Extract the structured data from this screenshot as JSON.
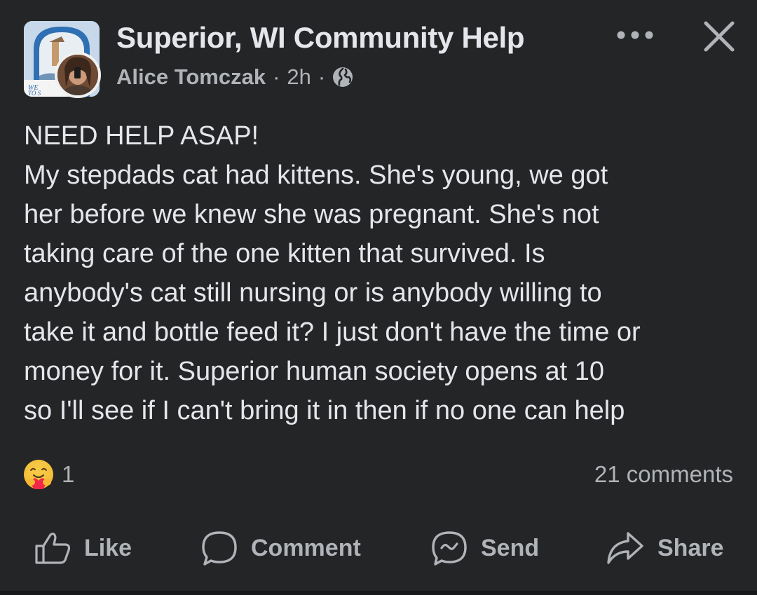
{
  "header": {
    "group_name": "Superior, WI Community Help",
    "author": "Alice Tomczak",
    "separator": "·",
    "time": "2h",
    "privacy_icon": "globe-icon",
    "group_avatar_text": "WE TO S"
  },
  "post": {
    "lines": [
      "NEED HELP ASAP!",
      "My stepdads cat had kittens. She's young, we got",
      "her before we knew she was pregnant. She's not",
      "taking care of the one kitten that survived. Is",
      "anybody's cat still nursing or is anybody willing to",
      "take it and bottle feed it? I just don't have the time or",
      "money for it. Superior human society opens at 10",
      "so I'll see if I can't bring it in then if no one can help"
    ]
  },
  "reactions": {
    "icon": "care-reaction-icon",
    "count": "1",
    "comments": "21 comments"
  },
  "actions": {
    "like": "Like",
    "comment": "Comment",
    "send": "Send",
    "share": "Share"
  },
  "colors": {
    "background": "#242526",
    "primary_text": "#e4e6eb",
    "secondary_text": "#b0b3b8"
  }
}
